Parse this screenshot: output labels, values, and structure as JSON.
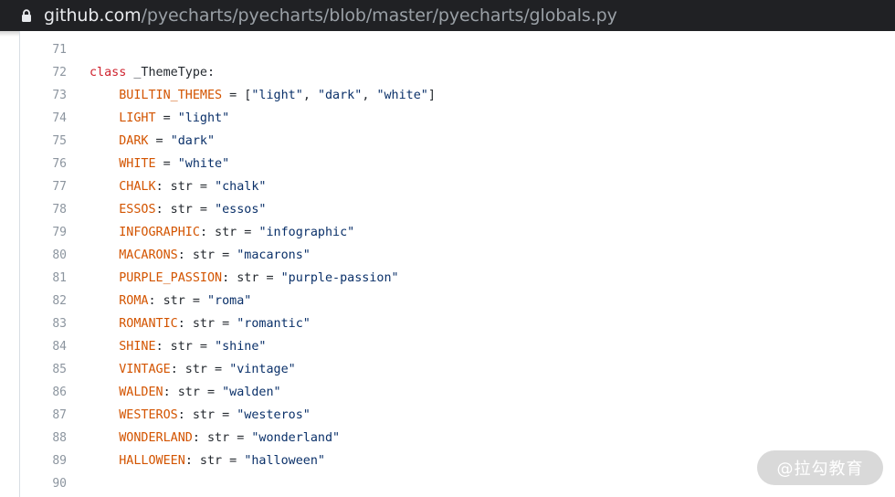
{
  "browser": {
    "url_host": "github.com",
    "url_path": "/pyecharts/pyecharts/blob/master/pyecharts/globals.py"
  },
  "code": {
    "lines": [
      {
        "num": "71",
        "tokens": []
      },
      {
        "num": "72",
        "tokens": [
          {
            "t": "class",
            "c": "kw"
          },
          {
            "t": " _ThemeType:",
            "c": "cls"
          }
        ]
      },
      {
        "num": "73",
        "tokens": [
          {
            "t": "    "
          },
          {
            "t": "BUILTIN_THEMES",
            "c": "var"
          },
          {
            "t": " = [",
            "c": "op"
          },
          {
            "t": "\"light\"",
            "c": "str"
          },
          {
            "t": ", ",
            "c": "op"
          },
          {
            "t": "\"dark\"",
            "c": "str"
          },
          {
            "t": ", ",
            "c": "op"
          },
          {
            "t": "\"white\"",
            "c": "str"
          },
          {
            "t": "]",
            "c": "op"
          }
        ]
      },
      {
        "num": "74",
        "tokens": [
          {
            "t": "    "
          },
          {
            "t": "LIGHT",
            "c": "var"
          },
          {
            "t": " = ",
            "c": "op"
          },
          {
            "t": "\"light\"",
            "c": "str"
          }
        ]
      },
      {
        "num": "75",
        "tokens": [
          {
            "t": "    "
          },
          {
            "t": "DARK",
            "c": "var"
          },
          {
            "t": " = ",
            "c": "op"
          },
          {
            "t": "\"dark\"",
            "c": "str"
          }
        ]
      },
      {
        "num": "76",
        "tokens": [
          {
            "t": "    "
          },
          {
            "t": "WHITE",
            "c": "var"
          },
          {
            "t": " = ",
            "c": "op"
          },
          {
            "t": "\"white\"",
            "c": "str"
          }
        ]
      },
      {
        "num": "77",
        "tokens": [
          {
            "t": "    "
          },
          {
            "t": "CHALK",
            "c": "var"
          },
          {
            "t": ": str = ",
            "c": "op"
          },
          {
            "t": "\"chalk\"",
            "c": "str"
          }
        ]
      },
      {
        "num": "78",
        "tokens": [
          {
            "t": "    "
          },
          {
            "t": "ESSOS",
            "c": "var"
          },
          {
            "t": ": str = ",
            "c": "op"
          },
          {
            "t": "\"essos\"",
            "c": "str"
          }
        ]
      },
      {
        "num": "79",
        "tokens": [
          {
            "t": "    "
          },
          {
            "t": "INFOGRAPHIC",
            "c": "var"
          },
          {
            "t": ": str = ",
            "c": "op"
          },
          {
            "t": "\"infographic\"",
            "c": "str"
          }
        ]
      },
      {
        "num": "80",
        "tokens": [
          {
            "t": "    "
          },
          {
            "t": "MACARONS",
            "c": "var"
          },
          {
            "t": ": str = ",
            "c": "op"
          },
          {
            "t": "\"macarons\"",
            "c": "str"
          }
        ]
      },
      {
        "num": "81",
        "tokens": [
          {
            "t": "    "
          },
          {
            "t": "PURPLE_PASSION",
            "c": "var"
          },
          {
            "t": ": str = ",
            "c": "op"
          },
          {
            "t": "\"purple-passion\"",
            "c": "str"
          }
        ]
      },
      {
        "num": "82",
        "tokens": [
          {
            "t": "    "
          },
          {
            "t": "ROMA",
            "c": "var"
          },
          {
            "t": ": str = ",
            "c": "op"
          },
          {
            "t": "\"roma\"",
            "c": "str"
          }
        ]
      },
      {
        "num": "83",
        "tokens": [
          {
            "t": "    "
          },
          {
            "t": "ROMANTIC",
            "c": "var"
          },
          {
            "t": ": str = ",
            "c": "op"
          },
          {
            "t": "\"romantic\"",
            "c": "str"
          }
        ]
      },
      {
        "num": "84",
        "tokens": [
          {
            "t": "    "
          },
          {
            "t": "SHINE",
            "c": "var"
          },
          {
            "t": ": str = ",
            "c": "op"
          },
          {
            "t": "\"shine\"",
            "c": "str"
          }
        ]
      },
      {
        "num": "85",
        "tokens": [
          {
            "t": "    "
          },
          {
            "t": "VINTAGE",
            "c": "var"
          },
          {
            "t": ": str = ",
            "c": "op"
          },
          {
            "t": "\"vintage\"",
            "c": "str"
          }
        ]
      },
      {
        "num": "86",
        "tokens": [
          {
            "t": "    "
          },
          {
            "t": "WALDEN",
            "c": "var"
          },
          {
            "t": ": str = ",
            "c": "op"
          },
          {
            "t": "\"walden\"",
            "c": "str"
          }
        ]
      },
      {
        "num": "87",
        "tokens": [
          {
            "t": "    "
          },
          {
            "t": "WESTEROS",
            "c": "var"
          },
          {
            "t": ": str = ",
            "c": "op"
          },
          {
            "t": "\"westeros\"",
            "c": "str"
          }
        ]
      },
      {
        "num": "88",
        "tokens": [
          {
            "t": "    "
          },
          {
            "t": "WONDERLAND",
            "c": "var"
          },
          {
            "t": ": str = ",
            "c": "op"
          },
          {
            "t": "\"wonderland\"",
            "c": "str"
          }
        ]
      },
      {
        "num": "89",
        "tokens": [
          {
            "t": "    "
          },
          {
            "t": "HALLOWEEN",
            "c": "var"
          },
          {
            "t": ": str = ",
            "c": "op"
          },
          {
            "t": "\"halloween\"",
            "c": "str"
          }
        ]
      },
      {
        "num": "90",
        "tokens": []
      }
    ]
  },
  "watermark": {
    "text": "@拉勾教育"
  },
  "colors": {
    "keyword": "#cf222e",
    "constant": "#d35400",
    "string": "#0a3069",
    "line_number": "#8c959f",
    "url_bar": "#202124"
  }
}
